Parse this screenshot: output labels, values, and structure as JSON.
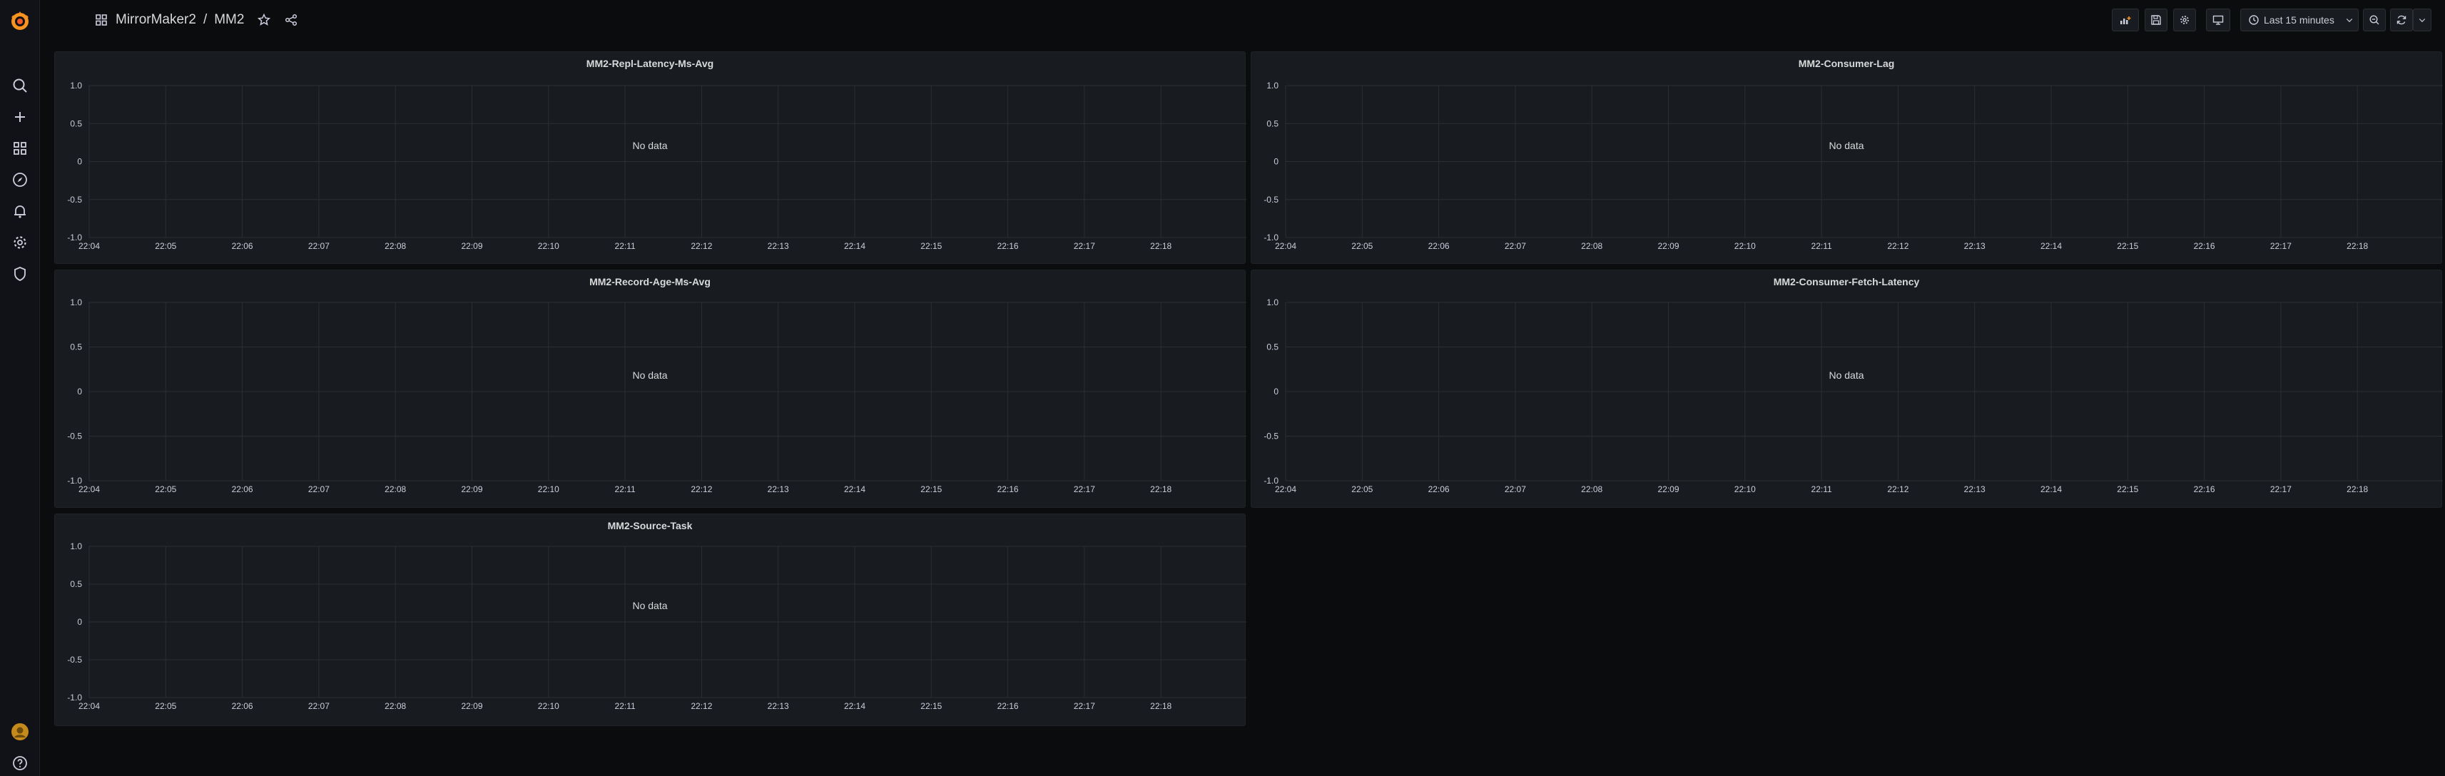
{
  "breadcrumb": {
    "folder": "MirrorMaker2",
    "separator": "/",
    "dashboard": "MM2"
  },
  "toolbar": {
    "time_range": "Last 15 minutes"
  },
  "colors": {
    "background": "#0b0c0e",
    "panel": "#181b1f",
    "grid": "#2c2e33",
    "text": "#ccccdc",
    "logo": "#f7931e"
  },
  "sidebar": {
    "items": [
      "search-icon",
      "plus-icon",
      "dashboards-icon",
      "explore-icon",
      "alerting-icon",
      "gear-icon",
      "shield-icon"
    ],
    "bottom": [
      "avatar",
      "help-icon"
    ]
  },
  "panels": [
    {
      "title": "MM2-Repl-Latency-Ms-Avg",
      "message": "No data"
    },
    {
      "title": "MM2-Consumer-Lag",
      "message": "No data"
    },
    {
      "title": "MM2-Record-Age-Ms-Avg",
      "message": "No data"
    },
    {
      "title": "MM2-Consumer-Fetch-Latency",
      "message": "No data"
    },
    {
      "title": "MM2-Source-Task",
      "message": "No data"
    }
  ],
  "chart_data": [
    {
      "type": "line",
      "title": "MM2-Repl-Latency-Ms-Avg",
      "x": [
        "22:04",
        "22:05",
        "22:06",
        "22:07",
        "22:08",
        "22:09",
        "22:10",
        "22:11",
        "22:12",
        "22:13",
        "22:14",
        "22:15",
        "22:16",
        "22:17",
        "22:18"
      ],
      "yticks": [
        "1.0",
        "0.5",
        "0",
        "-0.5",
        "-1.0"
      ],
      "ylim": [
        -1,
        1
      ],
      "series": [],
      "grid": true
    },
    {
      "type": "line",
      "title": "MM2-Consumer-Lag",
      "x": [
        "22:04",
        "22:05",
        "22:06",
        "22:07",
        "22:08",
        "22:09",
        "22:10",
        "22:11",
        "22:12",
        "22:13",
        "22:14",
        "22:15",
        "22:16",
        "22:17",
        "22:18"
      ],
      "yticks": [
        "1.0",
        "0.5",
        "0",
        "-0.5",
        "-1.0"
      ],
      "ylim": [
        -1,
        1
      ],
      "series": [],
      "grid": true
    },
    {
      "type": "line",
      "title": "MM2-Record-Age-Ms-Avg",
      "x": [
        "22:04",
        "22:05",
        "22:06",
        "22:07",
        "22:08",
        "22:09",
        "22:10",
        "22:11",
        "22:12",
        "22:13",
        "22:14",
        "22:15",
        "22:16",
        "22:17",
        "22:18"
      ],
      "yticks": [
        "1.0",
        "0.5",
        "0",
        "-0.5",
        "-1.0"
      ],
      "ylim": [
        -1,
        1
      ],
      "series": [],
      "grid": true
    },
    {
      "type": "line",
      "title": "MM2-Consumer-Fetch-Latency",
      "x": [
        "22:04",
        "22:05",
        "22:06",
        "22:07",
        "22:08",
        "22:09",
        "22:10",
        "22:11",
        "22:12",
        "22:13",
        "22:14",
        "22:15",
        "22:16",
        "22:17",
        "22:18"
      ],
      "yticks": [
        "1.0",
        "0.5",
        "0",
        "-0.5",
        "-1.0"
      ],
      "ylim": [
        -1,
        1
      ],
      "series": [],
      "grid": true
    },
    {
      "type": "line",
      "title": "MM2-Source-Task",
      "x": [
        "22:04",
        "22:05",
        "22:06",
        "22:07",
        "22:08",
        "22:09",
        "22:10",
        "22:11",
        "22:12",
        "22:13",
        "22:14",
        "22:15",
        "22:16",
        "22:17",
        "22:18"
      ],
      "yticks": [
        "1.0",
        "0.5",
        "0",
        "-0.5",
        "-1.0"
      ],
      "ylim": [
        -1,
        1
      ],
      "series": [],
      "grid": true
    }
  ]
}
